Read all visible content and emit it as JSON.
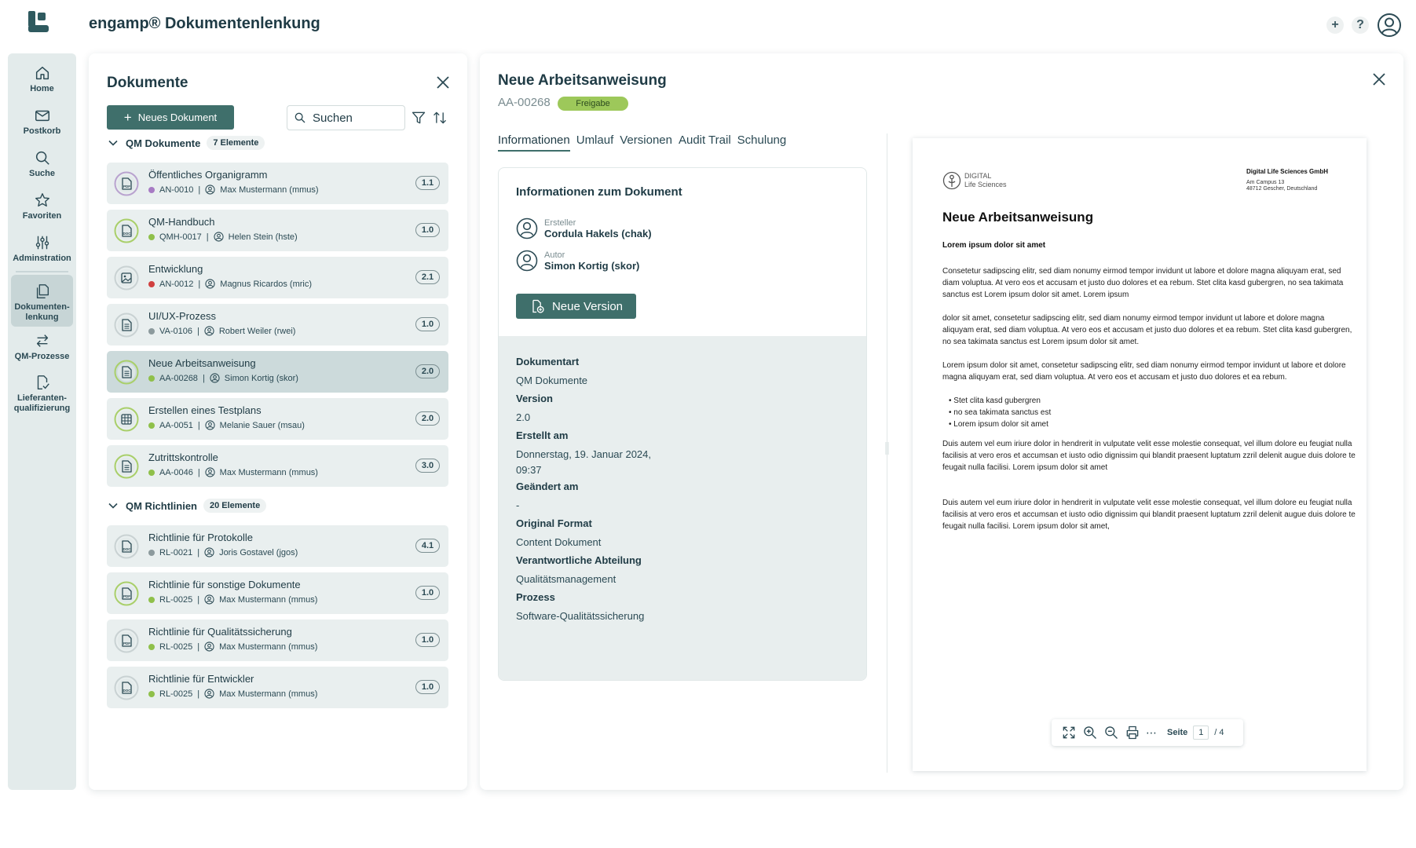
{
  "app": {
    "title": "engamp® Dokumentenlenkung"
  },
  "top_actions": {
    "add": "+",
    "help": "?"
  },
  "nav": [
    {
      "label": "Home",
      "icon": "home-icon"
    },
    {
      "label": "Postkorb",
      "icon": "mail-icon"
    },
    {
      "label": "Suche",
      "icon": "search-icon"
    },
    {
      "label": "Favoriten",
      "icon": "star-icon"
    },
    {
      "label": "Adminstration",
      "icon": "sliders-icon"
    },
    {
      "label": "Dokumenten-\nlenkung",
      "icon": "documents-icon",
      "active": true
    },
    {
      "label": "QM-Prozesse",
      "icon": "process-icon"
    },
    {
      "label": "Lieferanten-\nqualifizierung",
      "icon": "supplier-icon"
    }
  ],
  "documents_panel": {
    "title": "Dokumente",
    "new_button": "Neues Dokument",
    "search_placeholder": "Suchen",
    "groups": [
      {
        "name": "QM Dokumente",
        "count": "7 Elemente",
        "items": [
          {
            "name": "Öffentliches Organigramm",
            "id": "AN-0010",
            "user": "Max Mustermann (mmus)",
            "version": "1.1",
            "status_color": "#a77bc4",
            "icon": "pdf-icon",
            "ring": "#b9a3cf"
          },
          {
            "name": "QM-Handbuch",
            "id": "QMH-0017",
            "user": "Helen Stein (hste)",
            "version": "1.0",
            "status_color": "#8fc04a",
            "icon": "doc-icon",
            "ring": "#a9cf6a"
          },
          {
            "name": "Entwicklung",
            "id": "AN-0012",
            "user": "Magnus Ricardos (mric)",
            "version": "2.1",
            "status_color": "#d0403f",
            "icon": "image-icon",
            "ring": "#c9d2d3"
          },
          {
            "name": "UI/UX-Prozess",
            "id": "VA-0106",
            "user": "Robert Weiler (rwei)",
            "version": "1.0",
            "status_color": "#8c9a9d",
            "icon": "file-icon",
            "ring": "#c9d2d3"
          },
          {
            "name": "Neue Arbeitsanweisung",
            "id": "AA-00268",
            "user": "Simon Kortig (skor)",
            "version": "2.0",
            "status_color": "#8fc04a",
            "icon": "file-icon",
            "ring": "#a9cf6a",
            "selected": true
          },
          {
            "name": "Erstellen eines Testplans",
            "id": "AA-0051",
            "user": "Melanie Sauer (msau)",
            "version": "2.0",
            "status_color": "#8fc04a",
            "icon": "table-icon",
            "ring": "#a9cf6a"
          },
          {
            "name": "Zutrittskontrolle",
            "id": "AA-0046",
            "user": "Max Mustermann (mmus)",
            "version": "3.0",
            "status_color": "#8fc04a",
            "icon": "file-icon",
            "ring": "#a9cf6a"
          }
        ]
      },
      {
        "name": "QM Richtlinien",
        "count": "20 Elemente",
        "items": [
          {
            "name": "Richtlinie für Protokolle",
            "id": "RL-0021",
            "user": "Joris Gostavel (jgos)",
            "version": "4.1",
            "status_color": "#8c9a9d",
            "icon": "doc-icon",
            "ring": "#c9d2d3"
          },
          {
            "name": "Richtlinie für sonstige Dokumente",
            "id": "RL-0025",
            "user": "Max Mustermann (mmus)",
            "version": "1.0",
            "status_color": "#8fc04a",
            "icon": "pdf-icon",
            "ring": "#a9cf6a"
          },
          {
            "name": "Richtlinie für Qualitätssicherung",
            "id": "RL-0025",
            "user": "Max Mustermann (mmus)",
            "version": "1.0",
            "status_color": "#8fc04a",
            "icon": "pdf-icon",
            "ring": "#c9d2d3"
          },
          {
            "name": "Richtlinie für Entwickler",
            "id": "RL-0025",
            "user": "Max Mustermann (mmus)",
            "version": "1.0",
            "status_color": "#8fc04a",
            "icon": "doc-icon",
            "ring": "#c9d2d3"
          }
        ]
      }
    ]
  },
  "detail": {
    "title": "Neue Arbeitsanweisung",
    "id": "AA-00268",
    "status": "Freigabe",
    "tabs": [
      "Informationen",
      "Umlauf",
      "Versionen",
      "Audit Trail",
      "Schulung"
    ],
    "active_tab": "Informationen",
    "info": {
      "heading": "Informationen zum Dokument",
      "creator_role": "Ersteller",
      "creator_name": "Cordula Hakels (chak)",
      "author_role": "Autor",
      "author_name": "Simon Kortig (skor)",
      "new_version_button": "Neue Version",
      "fields": [
        {
          "label": "Dokumentart",
          "value": "QM Dokumente"
        },
        {
          "label": "Version",
          "value": "2.0"
        },
        {
          "label": "Erstellt am",
          "value": "Donnerstag, 19. Januar 2024,\n09:37"
        },
        {
          "label": "Geändert am",
          "value": "-"
        },
        {
          "label": "Original Format",
          "value": "Content Dokument"
        },
        {
          "label": "Verantwortliche Abteilung",
          "value": "Qualitätsmanagement"
        },
        {
          "label": "Prozess",
          "value": "Software-Qualitätssicherung"
        }
      ]
    },
    "preview": {
      "logo_line1": "DIGITAL",
      "logo_line2": "Life Sciences",
      "company": "Digital Life Sciences GmbH",
      "address1": "Am Campus 13",
      "address2": "48712 Gescher, Deutschland",
      "title": "Neue Arbeitsanweisung",
      "subtitle": "Lorem ipsum dolor sit amet",
      "paragraphs": [
        "Consetetur sadipscing elitr, sed diam nonumy eirmod tempor invidunt ut labore et dolore magna aliquyam erat, sed diam voluptua. At vero eos et accusam et justo duo dolores et ea rebum. Stet clita kasd gubergren, no sea takimata sanctus est Lorem ipsum dolor sit amet. Lorem ipsum",
        "dolor sit amet, consetetur sadipscing elitr, sed diam nonumy eirmod tempor invidunt ut labore et dolore magna aliquyam erat, sed diam voluptua. At vero eos et accusam et justo duo dolores et ea rebum. Stet clita kasd gubergren, no sea takimata sanctus est Lorem ipsum dolor sit amet.",
        "Lorem ipsum dolor sit amet, consetetur sadipscing elitr, sed diam nonumy eirmod tempor invidunt ut labore et dolore magna aliquyam erat, sed diam voluptua. At vero eos et accusam et justo duo dolores et ea rebum.",
        "Duis autem vel eum iriure dolor in hendrerit in vulputate velit esse molestie consequat, vel illum dolore eu feugiat nulla facilisis at vero eros et accumsan et iusto odio dignissim qui blandit praesent luptatum zzril delenit augue duis dolore te feugait nulla facilisi. Lorem ipsum dolor sit amet",
        "Duis autem vel eum iriure dolor in hendrerit in vulputate velit esse molestie consequat, vel illum dolore eu feugiat nulla facilisis at vero eros et accumsan et iusto odio dignissim qui blandit praesent luptatum zzril delenit augue duis dolore te feugait nulla facilisi. Lorem ipsum dolor sit amet,"
      ],
      "bullets": [
        "Stet clita kasd gubergren",
        "no sea takimata sanctus est",
        "Lorem ipsum dolor sit amet"
      ],
      "toolbar": {
        "page_label": "Seite",
        "page": "1",
        "total": "/ 4",
        "more": "⋯"
      }
    }
  },
  "colors": {
    "primary": "#3f6f6b",
    "nav_bg": "#e3ebeb",
    "status_green": "#9dc85a",
    "text_dark": "#1f3b45"
  }
}
